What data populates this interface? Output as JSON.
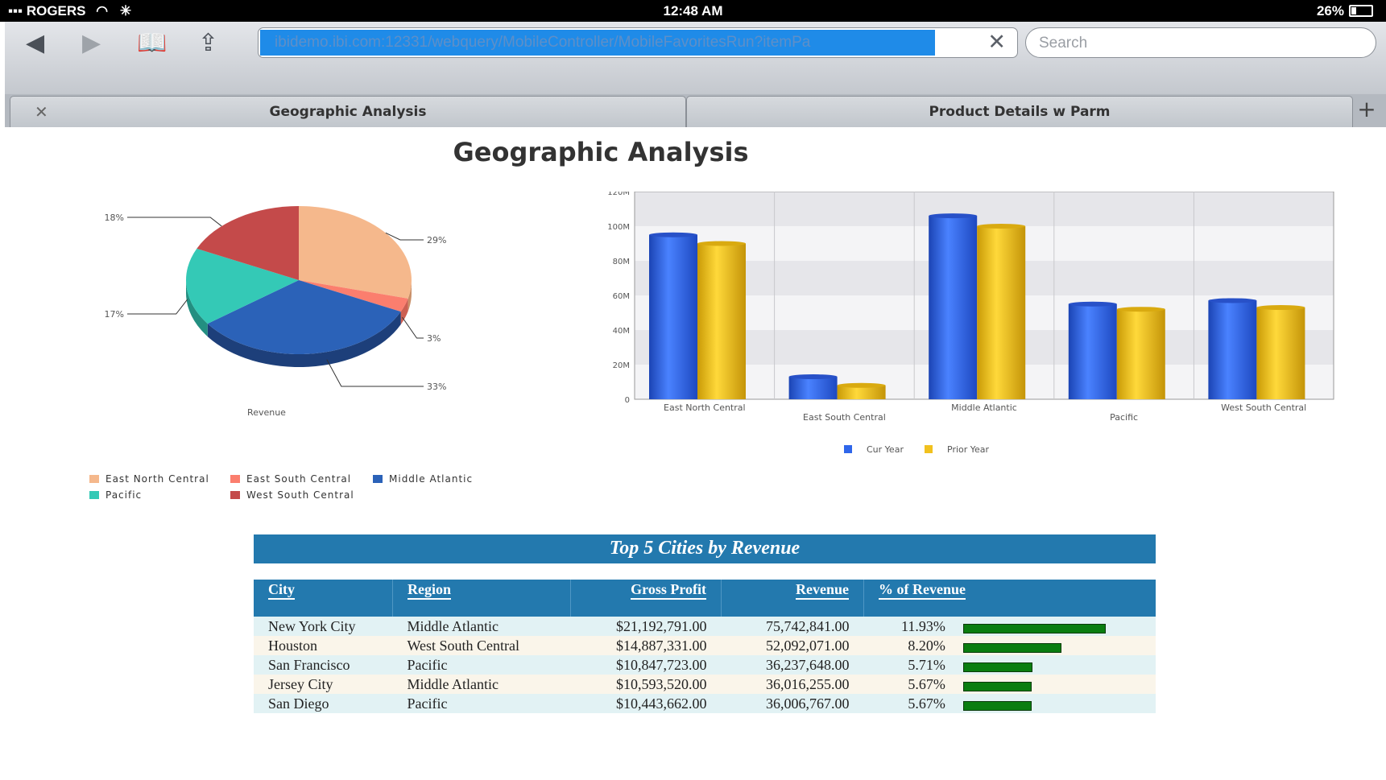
{
  "status": {
    "carrier": "ROGERS",
    "time": "12:48 AM",
    "battery": "26%"
  },
  "browser": {
    "url": "ibidemo.ibi.com:12331/webquery/MobileController/MobileFavoritesRun?itemPa",
    "search_placeholder": "Search",
    "tabs": [
      {
        "label": "Geographic Analysis"
      },
      {
        "label": "Product Details w Parm"
      }
    ]
  },
  "page": {
    "title": "Geographic Analysis"
  },
  "colors": {
    "ENC": "#f5b88c",
    "ESC": "#fb7e6e",
    "MA": "#2b62b8",
    "PAC": "#34c9b6",
    "WSC": "#c44a4a",
    "cur": "#2f66ea",
    "prior": "#f1c11e",
    "table_header": "#2379ae",
    "bar_fill": "#0a7d10"
  },
  "chart_data": [
    {
      "type": "pie",
      "title": "",
      "label": "Revenue",
      "slices": [
        {
          "name": "East North Central",
          "value": 29,
          "label": "29%"
        },
        {
          "name": "East South Central",
          "value": 3,
          "label": "3%"
        },
        {
          "name": "Middle Atlantic",
          "value": 33,
          "label": "33%"
        },
        {
          "name": "Pacific",
          "value": 17,
          "label": "17%"
        },
        {
          "name": "West South Central",
          "value": 18,
          "label": "18%"
        }
      ]
    },
    {
      "type": "bar",
      "categories": [
        "East North Central",
        "East South Central",
        "Middle Atlantic",
        "Pacific",
        "West South Central"
      ],
      "series": [
        {
          "name": "Cur Year",
          "values": [
            95,
            13,
            106,
            55,
            57
          ]
        },
        {
          "name": "Prior Year",
          "values": [
            90,
            8,
            100,
            52,
            53
          ]
        }
      ],
      "yticks": [
        "0",
        "20M",
        "40M",
        "60M",
        "80M",
        "100M",
        "120M"
      ],
      "ylim": [
        0,
        120
      ],
      "legend": "bottom"
    }
  ],
  "table": {
    "title": "Top 5 Cities by Revenue",
    "headers": [
      "City",
      "Region",
      "Gross Profit",
      "Revenue",
      "% of Revenue"
    ],
    "rows": [
      {
        "city": "New York City",
        "region": "Middle Atlantic",
        "gross_profit": "$21,192,791.00",
        "revenue": "75,742,841.00",
        "pct": "11.93%",
        "pct_value": 11.93
      },
      {
        "city": "Houston",
        "region": "West South Central",
        "gross_profit": "$14,887,331.00",
        "revenue": "52,092,071.00",
        "pct": "8.20%",
        "pct_value": 8.2
      },
      {
        "city": "San Francisco",
        "region": "Pacific",
        "gross_profit": "$10,847,723.00",
        "revenue": "36,237,648.00",
        "pct": "5.71%",
        "pct_value": 5.71
      },
      {
        "city": "Jersey City",
        "region": "Middle Atlantic",
        "gross_profit": "$10,593,520.00",
        "revenue": "36,016,255.00",
        "pct": "5.67%",
        "pct_value": 5.67
      },
      {
        "city": "San Diego",
        "region": "Pacific",
        "gross_profit": "$10,443,662.00",
        "revenue": "36,006,767.00",
        "pct": "5.67%",
        "pct_value": 5.67
      }
    ]
  }
}
